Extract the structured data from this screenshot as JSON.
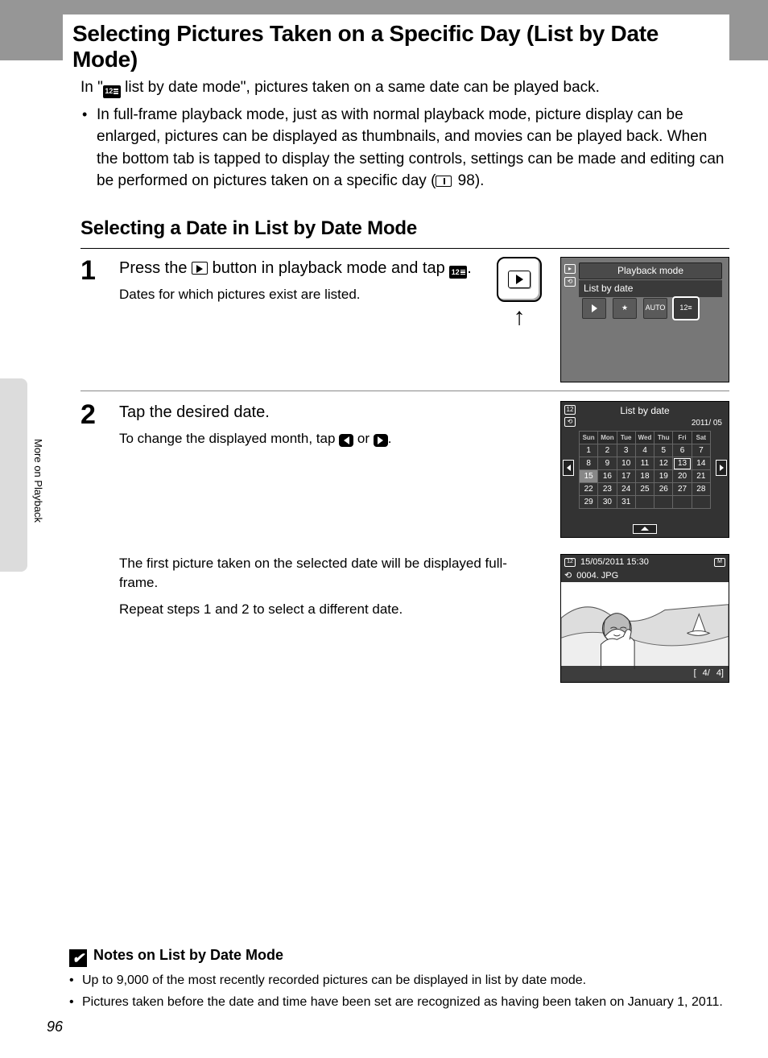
{
  "title": "Selecting Pictures Taken on a Specific Day (List by Date Mode)",
  "intro_pre": "In \"",
  "intro_post": " list by date mode\", pictures taken on a same date can be played back.",
  "bullet1": "In full-frame playback mode, just as with normal playback mode, picture display can be enlarged, pictures can be displayed as thumbnails, and movies can be played back. When the bottom tab is tapped to display the setting controls, settings can be made and editing can be performed on pictures taken on a specific day (",
  "bullet1_ref": " 98).",
  "subhead": "Selecting a Date in List by Date Mode",
  "step1": {
    "num": "1",
    "head_a": "Press the ",
    "head_b": " button in playback mode and tap ",
    "head_c": ".",
    "sub": "Dates for which pictures exist are listed."
  },
  "step2": {
    "num": "2",
    "head": "Tap the desired date.",
    "sub_a": "To change the displayed month, tap ",
    "sub_b": " or ",
    "sub_c": "."
  },
  "after": {
    "p1": "The first picture taken on the selected date will be displayed full-frame.",
    "p2": "Repeat steps 1 and 2 to select a different date."
  },
  "screens": {
    "s1": {
      "title": "Playback mode",
      "subtitle": "List by date",
      "auto": "AUTO",
      "cal": "12"
    },
    "s2": {
      "title": "List by date",
      "yearmonth": "2011/ 05",
      "dows": [
        "Sun",
        "Mon",
        "Tue",
        "Wed",
        "Thu",
        "Fri",
        "Sat"
      ],
      "rows": [
        [
          "1",
          "2",
          "3",
          "4",
          "5",
          "6",
          "7"
        ],
        [
          "8",
          "9",
          "10",
          "11",
          "12",
          "13",
          "14"
        ],
        [
          "15",
          "16",
          "17",
          "18",
          "19",
          "20",
          "21"
        ],
        [
          "22",
          "23",
          "24",
          "25",
          "26",
          "27",
          "28"
        ],
        [
          "29",
          "30",
          "31",
          "",
          "",
          "",
          ""
        ]
      ]
    },
    "s3": {
      "datetime": "15/05/2011 15:30",
      "filename": "0004. JPG",
      "counter_a": "4/",
      "counter_b": "4]",
      "batt": "["
    }
  },
  "notes": {
    "title": "Notes on List by Date Mode",
    "n1": "Up to 9,000 of the most recently recorded pictures can be displayed in list by date mode.",
    "n2": "Pictures taken before the date and time have been set are recognized as having been taken on January 1, 2011."
  },
  "side_label": "More on Playback",
  "page_number": "96"
}
